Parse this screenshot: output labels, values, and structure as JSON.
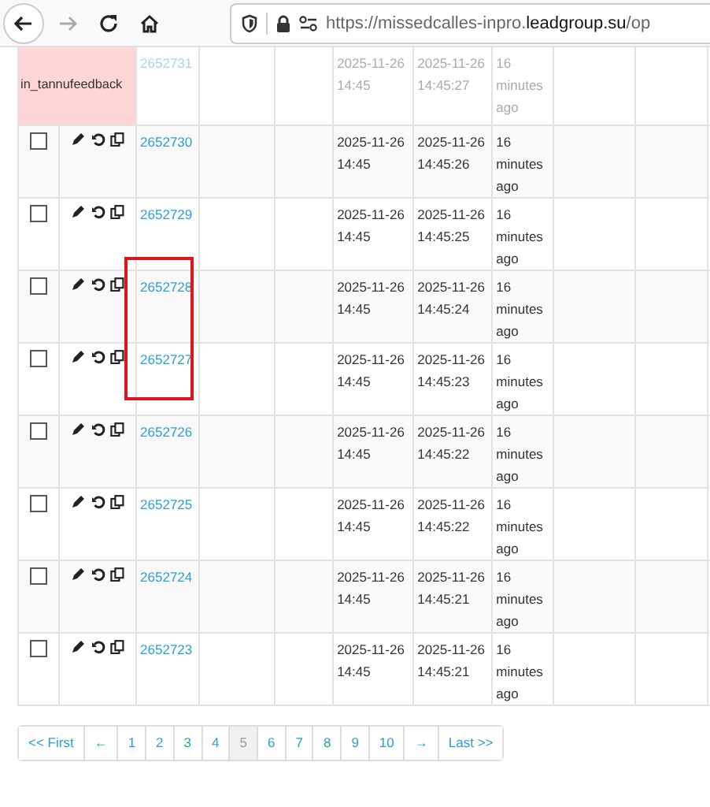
{
  "browser": {
    "back_enabled": true,
    "forward_enabled": false,
    "url": "https://missedcalles-inpro.**leadgroup.su**/op"
  },
  "table": {
    "rows": [
      {
        "kind": "tag",
        "faded": true,
        "highlighted": false,
        "tag": "in_tannufeedback",
        "id": "2652731",
        "created": "2025-11-26 14:45",
        "updated": "2025-11-26 14:45:27",
        "age": "16 minutes ago"
      },
      {
        "kind": "record",
        "faded": false,
        "highlighted": false,
        "checked": false,
        "id": "2652730",
        "created": "2025-11-26 14:45",
        "updated": "2025-11-26 14:45:26",
        "age": "16 minutes ago"
      },
      {
        "kind": "record",
        "faded": false,
        "highlighted": false,
        "checked": false,
        "id": "2652729",
        "created": "2025-11-26 14:45",
        "updated": "2025-11-26 14:45:25",
        "age": "16 minutes ago"
      },
      {
        "kind": "record",
        "faded": false,
        "highlighted": true,
        "checked": false,
        "id": "2652728",
        "created": "2025-11-26 14:45",
        "updated": "2025-11-26 14:45:24",
        "age": "16 minutes ago"
      },
      {
        "kind": "record",
        "faded": false,
        "highlighted": true,
        "checked": false,
        "id": "2652727",
        "created": "2025-11-26 14:45",
        "updated": "2025-11-26 14:45:23",
        "age": "16 minutes ago"
      },
      {
        "kind": "record",
        "faded": false,
        "highlighted": false,
        "checked": false,
        "id": "2652726",
        "created": "2025-11-26 14:45",
        "updated": "2025-11-26 14:45:22",
        "age": "16 minutes ago"
      },
      {
        "kind": "record",
        "faded": false,
        "highlighted": false,
        "checked": false,
        "id": "2652725",
        "created": "2025-11-26 14:45",
        "updated": "2025-11-26 14:45:22",
        "age": "16 minutes ago"
      },
      {
        "kind": "record",
        "faded": false,
        "highlighted": false,
        "checked": false,
        "id": "2652724",
        "created": "2025-11-26 14:45",
        "updated": "2025-11-26 14:45:21",
        "age": "16 minutes ago"
      },
      {
        "kind": "record",
        "faded": false,
        "highlighted": false,
        "checked": false,
        "id": "2652723",
        "created": "2025-11-26 14:45",
        "updated": "2025-11-26 14:45:21",
        "age": "16 minutes ago"
      }
    ]
  },
  "pagination": [
    {
      "label": "<< First",
      "selected": false
    },
    {
      "label": "←",
      "selected": false
    },
    {
      "label": "1",
      "selected": false
    },
    {
      "label": "2",
      "selected": false
    },
    {
      "label": "3",
      "selected": false
    },
    {
      "label": "4",
      "selected": false
    },
    {
      "label": "5",
      "selected": true
    },
    {
      "label": "6",
      "selected": false
    },
    {
      "label": "7",
      "selected": false
    },
    {
      "label": "8",
      "selected": false
    },
    {
      "label": "9",
      "selected": false
    },
    {
      "label": "10",
      "selected": false
    },
    {
      "label": "→",
      "selected": false
    },
    {
      "label": "Last >>",
      "selected": false
    }
  ]
}
